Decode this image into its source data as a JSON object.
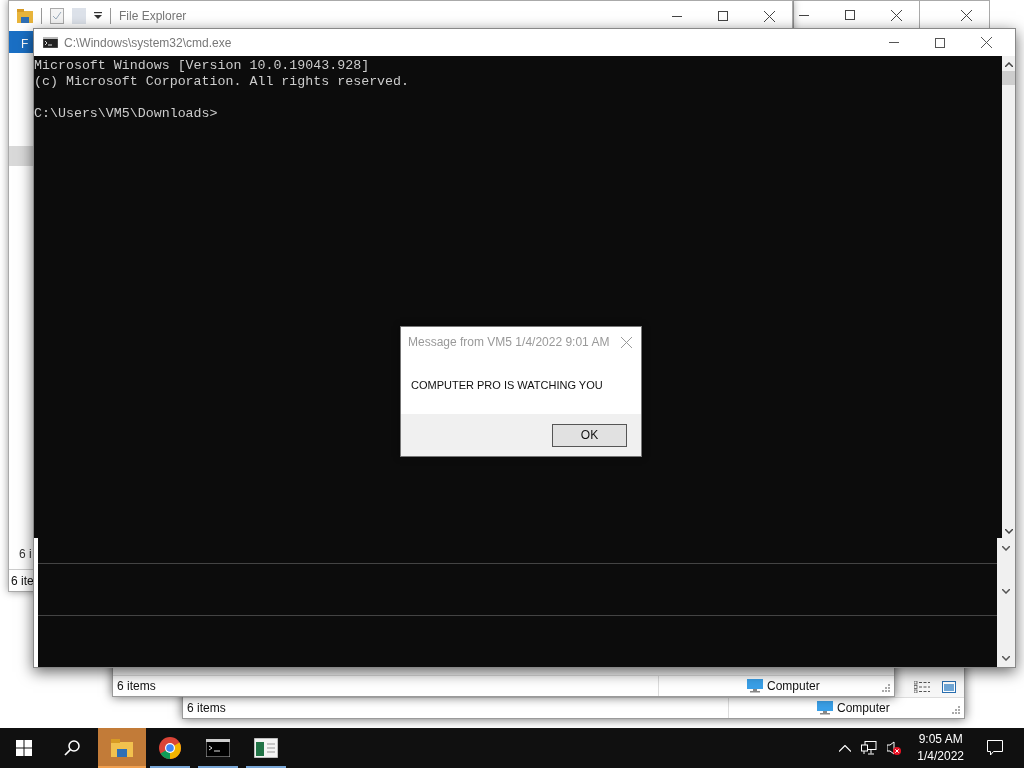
{
  "file_explorer": {
    "title": "File Explorer",
    "ribbon_tab": "F",
    "status": "6 ite"
  },
  "hidden_window": {
    "status": "6 i"
  },
  "explorer_windows_behind": [
    {
      "status": "6 items",
      "location": "Computer"
    },
    {
      "status": "6 items",
      "location": "Computer"
    }
  ],
  "cmd_window": {
    "title": "C:\\Windows\\system32\\cmd.exe",
    "lines": [
      "Microsoft Windows [Version 10.0.19043.928]",
      "(c) Microsoft Corporation. All rights reserved."
    ],
    "prompt": "C:\\Users\\VM5\\Downloads>"
  },
  "dialog": {
    "title": "Message from VM5 1/4/2022 9:01 AM",
    "message": "COMPUTER PRO IS WATCHING YOU",
    "button": "OK"
  },
  "taskbar": {
    "apps": [
      {
        "kind": "explorer",
        "selected": true
      },
      {
        "kind": "chrome",
        "selected": false
      },
      {
        "kind": "cmd",
        "selected": false
      },
      {
        "kind": "app",
        "selected": false
      }
    ],
    "clock": {
      "time": "9:05 AM",
      "date": "1/4/2022"
    }
  }
}
